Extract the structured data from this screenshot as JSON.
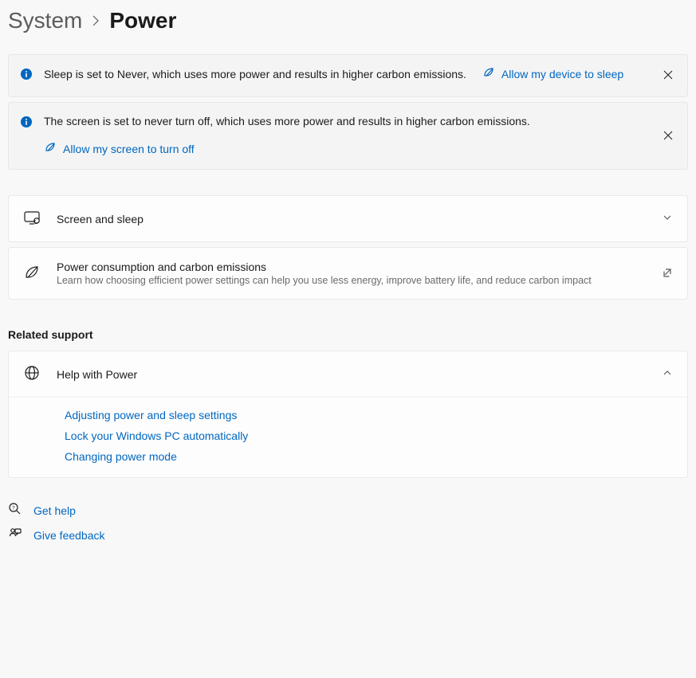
{
  "breadcrumb": {
    "parent": "System",
    "current": "Power"
  },
  "banners": {
    "sleep": {
      "message": "Sleep is set to Never, which uses more power and results in higher carbon emissions.",
      "action": "Allow my device to sleep"
    },
    "screen": {
      "message": "The screen is set to never turn off, which uses more power and results in higher carbon emissions.",
      "action": "Allow my screen to turn off"
    }
  },
  "cards": {
    "screen_sleep": {
      "title": "Screen and sleep"
    },
    "carbon": {
      "title": "Power consumption and carbon emissions",
      "subtitle": "Learn how choosing efficient power settings can help you use less energy, improve battery life, and reduce carbon impact"
    }
  },
  "related_support_heading": "Related support",
  "help": {
    "title": "Help with Power",
    "links": {
      "adjust": "Adjusting power and sleep settings",
      "lock": "Lock your Windows PC automatically",
      "mode": "Changing power mode"
    }
  },
  "footer": {
    "get_help": "Get help",
    "give_feedback": "Give feedback"
  }
}
